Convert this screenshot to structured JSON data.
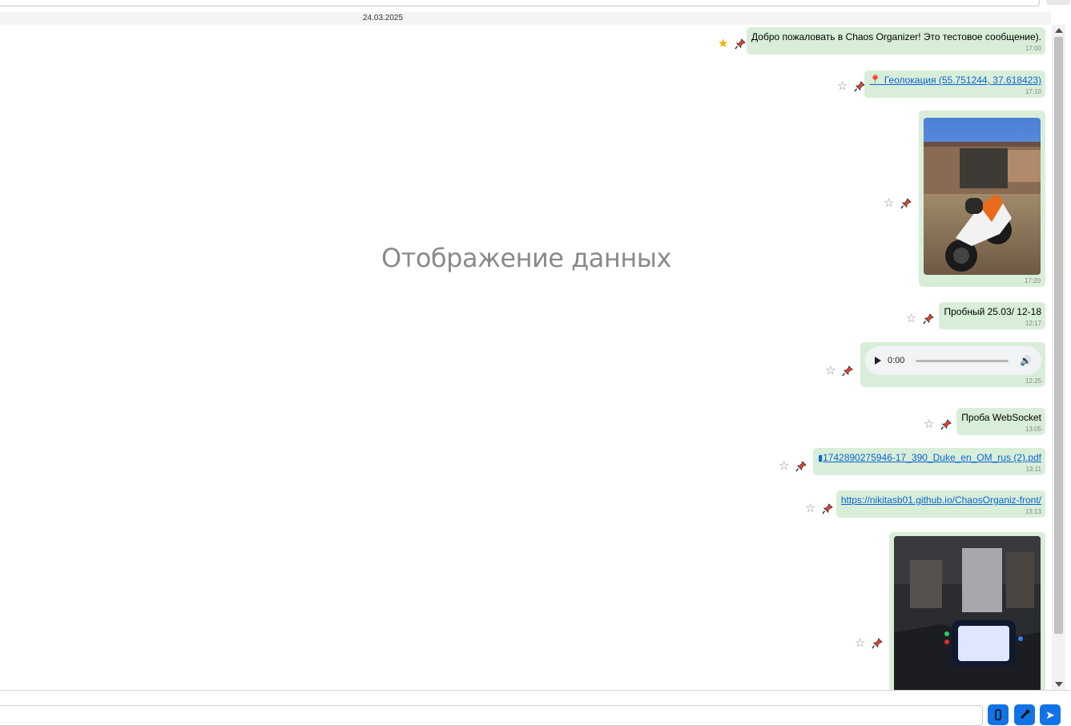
{
  "search": {
    "placeholder": ""
  },
  "date_separator": "24.03.2025",
  "watermark": "Отображение данных",
  "messages": [
    {
      "text": "Добро пожаловать в Chaos Organizer! Это тестовое сообщение).",
      "time": "17:00",
      "starred": true
    },
    {
      "text": "📍 Геолокация (55.751244, 37.618423)",
      "time": "17:10",
      "starred": false
    },
    {
      "text": "",
      "time": "17:20",
      "starred": false,
      "image": "motorcycle-photo"
    },
    {
      "text": "Пробный 25.03/ 12-18",
      "time": "12:17",
      "starred": false
    },
    {
      "text": "",
      "time": "12:25",
      "starred": false,
      "audio_time": "0:00"
    },
    {
      "text": "Проба WebSocket",
      "time": "13:05",
      "starred": false
    },
    {
      "text": "1742890275946-17_390_Duke_en_OM_rus (2).pdf",
      "time": "13:11",
      "starred": false
    },
    {
      "text": "https://nikitasb01.github.io/ChaosOrganiz-front/",
      "time": "13:13",
      "starred": false
    },
    {
      "text": "",
      "time": "",
      "starred": false,
      "image": "dashboard-photo"
    }
  ],
  "colors": {
    "bubble": "#d8eed8",
    "link": "#0b63d6",
    "star_on": "#f0b400",
    "button": "#1273e6"
  },
  "composer": {
    "placeholder": ""
  },
  "icons": {
    "star": "☆",
    "star_filled": "★",
    "attach": "paperclip-icon",
    "mic": "microphone-icon",
    "send": "➤"
  }
}
